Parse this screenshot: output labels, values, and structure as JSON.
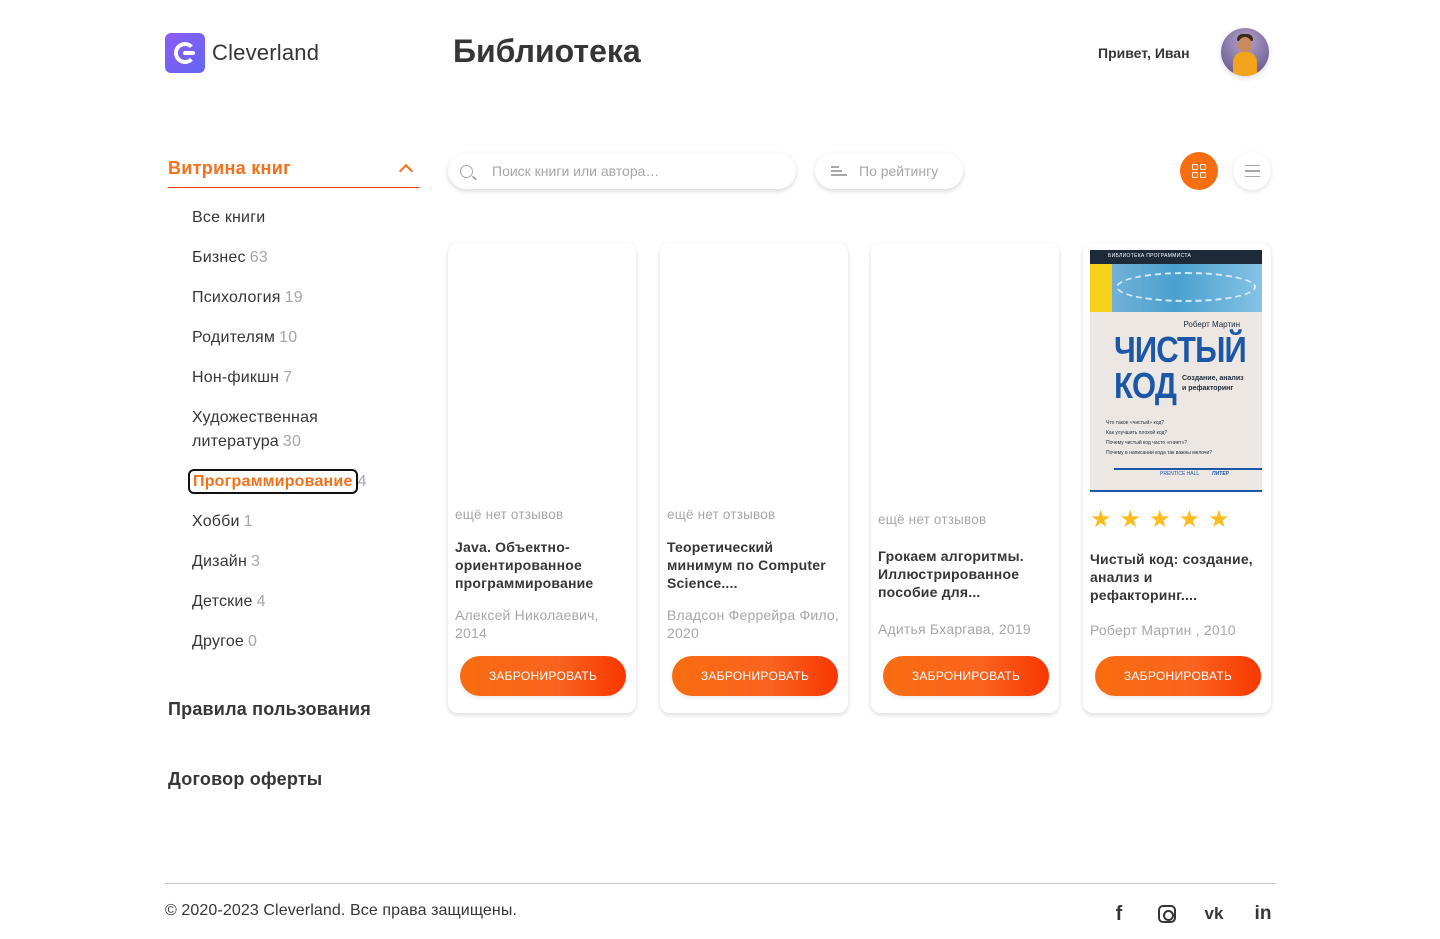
{
  "header": {
    "logo_text": "Cleverland",
    "page_title": "Библиотека",
    "greeting": "Привет, Иван"
  },
  "sidebar": {
    "section_title": "Витрина книг",
    "categories": [
      {
        "name": "Все книги",
        "count": ""
      },
      {
        "name": "Бизнес",
        "count": "63"
      },
      {
        "name": "Психология",
        "count": "19"
      },
      {
        "name": "Родителям",
        "count": "10"
      },
      {
        "name": "Нон-фикшн",
        "count": "7"
      },
      {
        "name": "Художественная литература",
        "count": "30"
      },
      {
        "name": "Программирование",
        "count": "4"
      },
      {
        "name": "Хобби",
        "count": "1"
      },
      {
        "name": "Дизайн",
        "count": "3"
      },
      {
        "name": "Детские",
        "count": "4"
      },
      {
        "name": "Другое",
        "count": "0"
      }
    ],
    "active_category": "Программирование",
    "rules_link": "Правила пользования",
    "offer_link": "Договор оферты"
  },
  "toolbar": {
    "search_placeholder": "Поиск книги или автора…",
    "sort_label": "По рейтингу",
    "active_view": "grid"
  },
  "books": [
    {
      "no_reviews": "ещё нет отзывов",
      "title": "Java. Объектно-ориентированное программирование",
      "author": "Алексей Николаевич, 2014",
      "button": "ЗАБРОНИРОВАТЬ",
      "rating": null,
      "has_cover": false
    },
    {
      "no_reviews": "ещё нет отзывов",
      "title": "Теоретический минимум по Computer Science....",
      "author": "Владсон Феррейра Фило, 2020",
      "button": "ЗАБРОНИРОВАТЬ",
      "rating": null,
      "has_cover": false
    },
    {
      "no_reviews": "ещё нет отзывов",
      "title": "Грокаем алгоритмы. Иллюстрированное пособие для...",
      "author": "Адитья Бхаргава, 2019",
      "button": "ЗАБРОНИРОВАТЬ",
      "rating": null,
      "has_cover": false
    },
    {
      "no_reviews": "",
      "title": "Чистый код: создание, анализ и рефакторинг....",
      "author": "Роберт Мартин , 2010",
      "button": "ЗАБРОНИРОВАТЬ",
      "rating": 5,
      "has_cover": true,
      "cover": {
        "series": "БИБЛИОТЕКА ПРОГРАММИСТА",
        "author": "Роберт Мартин",
        "title_line1": "ЧИСТЫЙ",
        "title_line2": "КОД",
        "subtitle": "Создание, анализ и рефакторинг",
        "bullets": [
          "Что такое «чистый» код?",
          "Как улучшить плохой код?",
          "Почему чистый код часто «гниет»?",
          "Почему в написании кода так важны мелочи?"
        ],
        "publisher1": "PRENTICE HALL",
        "publisher2": "ПИТЕР"
      }
    }
  ],
  "colors": {
    "accent": "#f86d10",
    "accent_dark": "#f83600",
    "star": "#ffbc1f",
    "text": "#363636",
    "muted": "#a7a7a7"
  },
  "footer": {
    "copyright": "© 2020-2023 Cleverland. Все права защищены.",
    "social_icons": [
      "facebook-icon",
      "instagram-icon",
      "vk-icon",
      "linkedin-icon"
    ]
  }
}
